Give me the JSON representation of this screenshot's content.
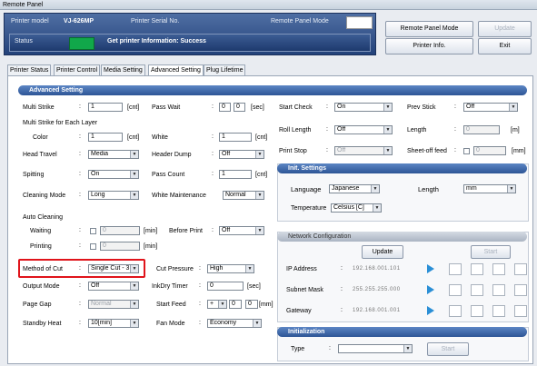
{
  "window": {
    "title": "Remote Panel"
  },
  "header": {
    "printer_model_label": "Printer model",
    "printer_model_value": "VJ-626MP",
    "serial_label": "Printer Serial No.",
    "serial_value": "",
    "remote_mode_label": "Remote Panel Mode",
    "status_label": "Status",
    "status_text": "Get printer Information: Success",
    "status_color": "#11a84a"
  },
  "right_buttons": {
    "remote_panel_mode": "Remote Panel Mode",
    "update": "Update",
    "printer_info": "Printer Info.",
    "exit": "Exit"
  },
  "tabs": [
    "Printer Status",
    "Printer Control",
    "Media Setting",
    "Advanced Setting",
    "Plug Lifetime"
  ],
  "advanced": {
    "section_title": "Advanced Setting",
    "multi_strike": {
      "label": "Multi Strike",
      "value": "1",
      "unit": "[cnt]"
    },
    "pass_wait": {
      "label": "Pass Wait",
      "value1": "0",
      "value2": "0",
      "unit": "[sec]"
    },
    "multi_strike_layer_label": "Multi Strike for Each Layer",
    "color": {
      "label": "Color",
      "value": "1",
      "unit": "[cnt]"
    },
    "white": {
      "label": "White",
      "value": "1",
      "unit": "[cnt]"
    },
    "head_travel": {
      "label": "Head Travel",
      "value": "Media"
    },
    "header_dump": {
      "label": "Header Dump",
      "value": "Off"
    },
    "spitting": {
      "label": "Spitting",
      "value": "On"
    },
    "pass_count": {
      "label": "Pass Count",
      "value": "1",
      "unit": "[cnt]"
    },
    "cleaning_mode": {
      "label": "Cleaning Mode",
      "value": "Long"
    },
    "white_maintenance": {
      "label": "White Maintenance",
      "value": "Normal"
    },
    "auto_cleaning_label": "Auto Cleaning",
    "waiting": {
      "label": "Waiting",
      "value": "0",
      "unit": "[min]"
    },
    "before_print": {
      "label": "Before Print",
      "value": "Off"
    },
    "printing": {
      "label": "Printing",
      "value": "0",
      "unit": "[min]"
    },
    "method_of_cut": {
      "label": "Method of Cut",
      "value": "Single Cut - 3"
    },
    "cut_pressure": {
      "label": "Cut Pressure",
      "value": "High"
    },
    "output_mode": {
      "label": "Output Mode",
      "value": "Off"
    },
    "ink_dry_timer": {
      "label": "InkDry Timer",
      "value": "0",
      "unit": "[sec]"
    },
    "page_gap": {
      "label": "Page Gap",
      "value": "Normal"
    },
    "start_feed": {
      "label": "Start Feed",
      "sign": "+",
      "value": "0",
      "unit": "[mm]"
    },
    "standby_heat": {
      "label": "Standby Heat",
      "value": "10[min]"
    },
    "fan_mode": {
      "label": "Fan Mode",
      "value": "Economy"
    },
    "start_check": {
      "label": "Start Check",
      "value": "On"
    },
    "prev_stick": {
      "label": "Prev Stick",
      "value": "Off"
    },
    "roll_length": {
      "label": "Roll Length",
      "value": "Off"
    },
    "length": {
      "label": "Length",
      "value": "0",
      "unit": "[m]"
    },
    "print_stop": {
      "label": "Print Stop",
      "value": "Off"
    },
    "sheet_off_feed": {
      "label": "Sheet-off feed",
      "value": "0",
      "unit": "[mm]"
    }
  },
  "init_settings": {
    "title": "Init. Settings",
    "language_label": "Language",
    "language_value": "Japanese",
    "length_label": "Length",
    "length_value": "mm",
    "temperature_label": "Temperature",
    "temperature_value": "Celsius [C]"
  },
  "network": {
    "title": "Network Configuration",
    "update_button": "Update",
    "start_button": "Start",
    "ip_label": "IP Address",
    "ip_value": "192.168.001.101",
    "subnet_label": "Subnet Mask",
    "subnet_value": "255.255.255.000",
    "gateway_label": "Gateway",
    "gateway_value": "192.168.001.001"
  },
  "initialization": {
    "title": "Initialization",
    "type_label": "Type",
    "type_value": "",
    "start_button": "Start"
  }
}
